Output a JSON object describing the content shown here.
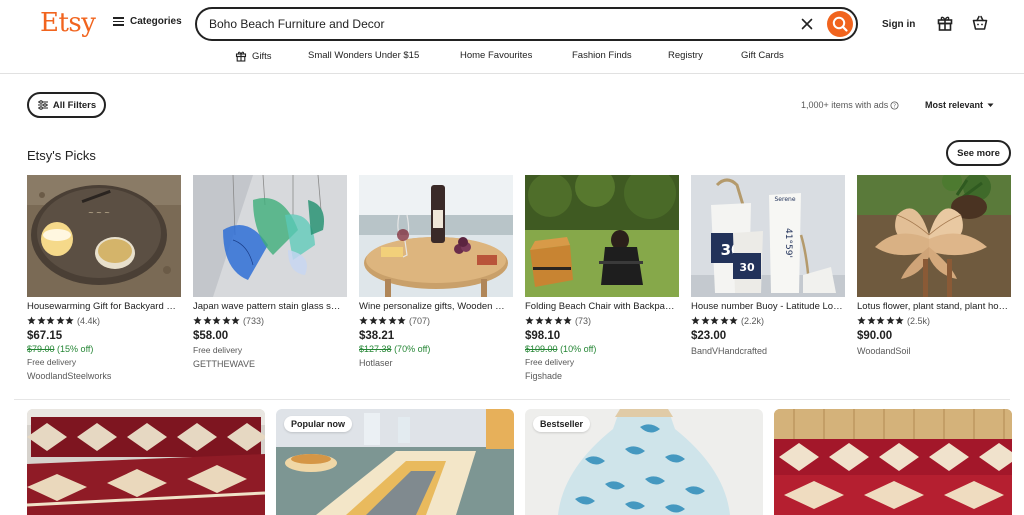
{
  "header": {
    "logo": "Etsy",
    "categories_label": "Categories",
    "search_value": "Boho Beach Furniture and Decor",
    "signin_label": "Sign in"
  },
  "nav": {
    "items": [
      {
        "label": "Gifts",
        "icon": "gift-icon"
      },
      {
        "label": "Small Wonders Under $15"
      },
      {
        "label": "Home Favourites"
      },
      {
        "label": "Fashion Finds"
      },
      {
        "label": "Registry"
      },
      {
        "label": "Gift Cards"
      }
    ]
  },
  "filters": {
    "all_filters_label": "All Filters",
    "results_text": "1,000+ items with ads",
    "sort_label": "Most relevant"
  },
  "picks": {
    "title": "Etsy's Picks",
    "see_more_label": "See more",
    "items": [
      {
        "title": "Housewarming Gift for Backyard Fire Pit Table",
        "rating_count": "(4.4k)",
        "price": "$67.15",
        "original_price": "$79.00",
        "discount": "(15% off)",
        "delivery": "Free delivery",
        "shop": "WoodlandSteelworks"
      },
      {
        "title": "Japan wave pattern stain glass suncatcher",
        "rating_count": "(733)",
        "price": "$58.00",
        "original_price": "",
        "discount": "",
        "delivery": "Free delivery",
        "shop": "GETTHEWAVE"
      },
      {
        "title": "Wine personalize gifts, Wooden wine table",
        "rating_count": "(707)",
        "price": "$38.21",
        "original_price": "$127.38",
        "discount": "(70% off)",
        "delivery": "",
        "shop": "Hotlaser"
      },
      {
        "title": "Folding Beach Chair with Backpack Straps",
        "rating_count": "(73)",
        "price": "$98.10",
        "original_price": "$109.00",
        "discount": "(10% off)",
        "delivery": "Free delivery",
        "shop": "Figshade"
      },
      {
        "title": "House number Buoy - Latitude Longitude",
        "rating_count": "(2.2k)",
        "price": "$23.00",
        "original_price": "",
        "discount": "",
        "delivery": "",
        "shop": "BandVHandcrafted"
      },
      {
        "title": "Lotus flower, plant stand, plant holder",
        "rating_count": "(2.5k)",
        "price": "$90.00",
        "original_price": "",
        "discount": "",
        "delivery": "",
        "shop": "WoodandSoil"
      }
    ]
  },
  "listings": [
    {
      "badge": ""
    },
    {
      "badge": "Popular now"
    },
    {
      "badge": "Bestseller"
    },
    {
      "badge": ""
    }
  ],
  "buoy_text": {
    "a": "30",
    "b": "30",
    "c": "41°59'",
    "d": "Serene"
  },
  "colors": {
    "accent": "#f1641e",
    "discount_green": "#258635",
    "text": "#222222",
    "muted": "#595959"
  }
}
